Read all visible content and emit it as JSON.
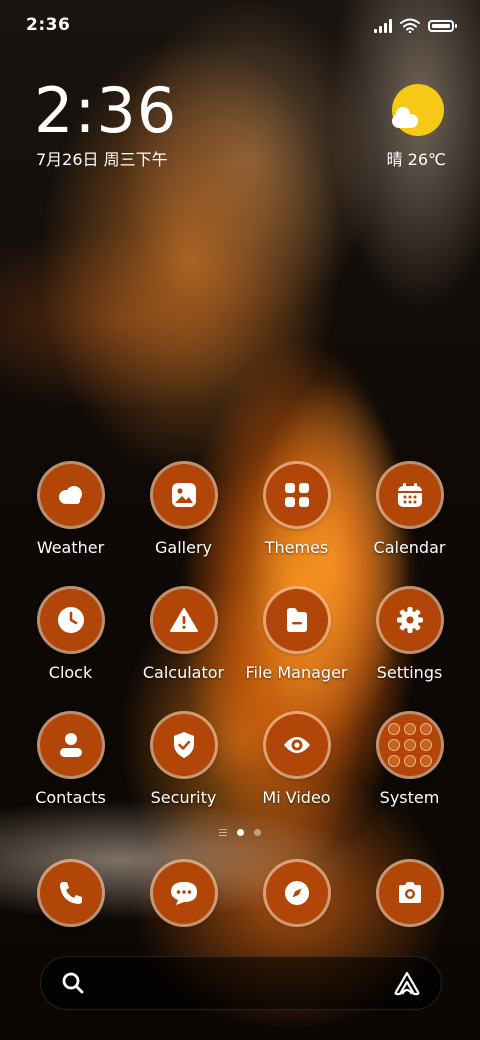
{
  "status_bar": {
    "time": "2:36",
    "icons": [
      "signal-icon",
      "wifi-icon",
      "battery-icon"
    ]
  },
  "lock_widget": {
    "time": "2:36",
    "date": "7月26日 周三下午"
  },
  "weather_widget": {
    "icon": "sun-cloud-icon",
    "text": "晴 26℃",
    "sun_color": "#f5c915"
  },
  "apps": [
    {
      "label": "Weather",
      "icon": "weather-icon"
    },
    {
      "label": "Gallery",
      "icon": "gallery-icon"
    },
    {
      "label": "Themes",
      "icon": "themes-icon"
    },
    {
      "label": "Calendar",
      "icon": "calendar-icon"
    },
    {
      "label": "Clock",
      "icon": "clock-icon"
    },
    {
      "label": "Calculator",
      "icon": "calculator-icon"
    },
    {
      "label": "File Manager",
      "icon": "file-manager-icon"
    },
    {
      "label": "Settings",
      "icon": "settings-icon"
    },
    {
      "label": "Contacts",
      "icon": "contacts-icon"
    },
    {
      "label": "Security",
      "icon": "security-icon"
    },
    {
      "label": "Mi Video",
      "icon": "mi-video-icon"
    },
    {
      "label": "System",
      "icon": "system-folder-icon"
    }
  ],
  "page_indicator": {
    "pages": 2,
    "current": 1
  },
  "dock": [
    {
      "icon": "phone-icon"
    },
    {
      "icon": "messages-icon"
    },
    {
      "icon": "browser-icon"
    },
    {
      "icon": "camera-icon"
    }
  ],
  "search_bar": {
    "left_icon": "search-icon",
    "right_icon": "assistant-icon"
  },
  "colors": {
    "icon_bg": "#b14608",
    "icon_ring": "#f5be96",
    "text": "#ffffff"
  }
}
